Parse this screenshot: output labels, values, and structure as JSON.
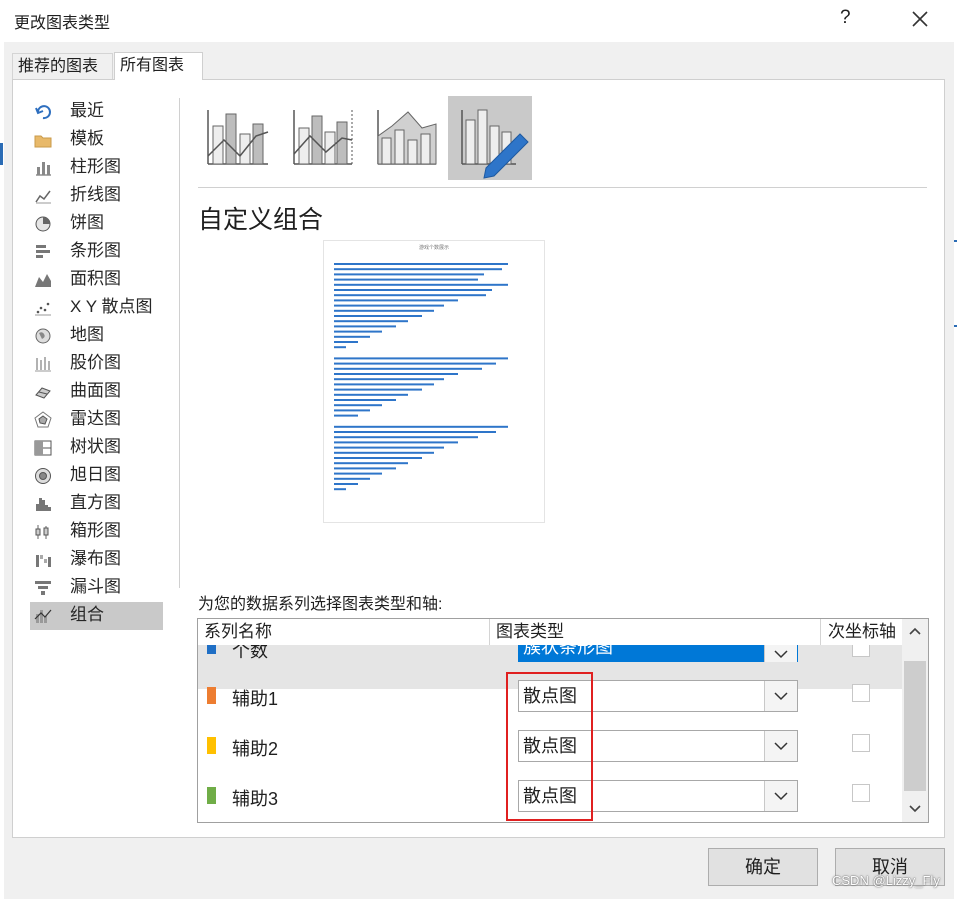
{
  "window": {
    "title": "更改图表类型",
    "help_label": "?",
    "close_icon": "close-icon"
  },
  "tabs": [
    {
      "label": "推荐的图表"
    },
    {
      "label": "所有图表"
    }
  ],
  "categories": [
    {
      "label": "最近",
      "icon": "undo-icon"
    },
    {
      "label": "模板",
      "icon": "folder-icon"
    },
    {
      "label": "柱形图",
      "icon": "column-chart-icon"
    },
    {
      "label": "折线图",
      "icon": "line-chart-icon"
    },
    {
      "label": "饼图",
      "icon": "pie-chart-icon"
    },
    {
      "label": "条形图",
      "icon": "bar-chart-icon"
    },
    {
      "label": "面积图",
      "icon": "area-chart-icon"
    },
    {
      "label": "X Y 散点图",
      "icon": "scatter-chart-icon"
    },
    {
      "label": "地图",
      "icon": "globe-icon"
    },
    {
      "label": "股价图",
      "icon": "stock-chart-icon"
    },
    {
      "label": "曲面图",
      "icon": "surface-chart-icon"
    },
    {
      "label": "雷达图",
      "icon": "radar-chart-icon"
    },
    {
      "label": "树状图",
      "icon": "treemap-icon"
    },
    {
      "label": "旭日图",
      "icon": "sunburst-icon"
    },
    {
      "label": "直方图",
      "icon": "histogram-icon"
    },
    {
      "label": "箱形图",
      "icon": "box-whisker-icon"
    },
    {
      "label": "瀑布图",
      "icon": "waterfall-icon"
    },
    {
      "label": "漏斗图",
      "icon": "funnel-icon"
    },
    {
      "label": "组合",
      "icon": "combo-chart-icon"
    }
  ],
  "selected_category": "组合",
  "subtypes": [
    {
      "name": "clustered-column-line"
    },
    {
      "name": "clustered-column-line-secondary-axis"
    },
    {
      "name": "stacked-area-clustered-column"
    },
    {
      "name": "custom-combination"
    }
  ],
  "custom_title": "自定义组合",
  "preview": {
    "title": "游戏个数展示"
  },
  "series_prompt": "为您的数据系列选择图表类型和轴:",
  "table": {
    "headers": {
      "name": "系列名称",
      "type": "图表类型",
      "secondary": "次坐标轴"
    },
    "rows": [
      {
        "name": "个数",
        "type": "簇状条形图",
        "color": "#1f6fc5",
        "secondary": false,
        "highlight": true
      },
      {
        "name": "辅助1",
        "type": "散点图",
        "color": "#ed7d31",
        "secondary": false
      },
      {
        "name": "辅助2",
        "type": "散点图",
        "color": "#ffc000",
        "secondary": false
      },
      {
        "name": "辅助3",
        "type": "散点图",
        "color": "#70ad47",
        "secondary": false
      }
    ]
  },
  "buttons": {
    "ok": "确定",
    "cancel": "取消"
  },
  "watermark": "CSDN @Lizzy_Fly"
}
